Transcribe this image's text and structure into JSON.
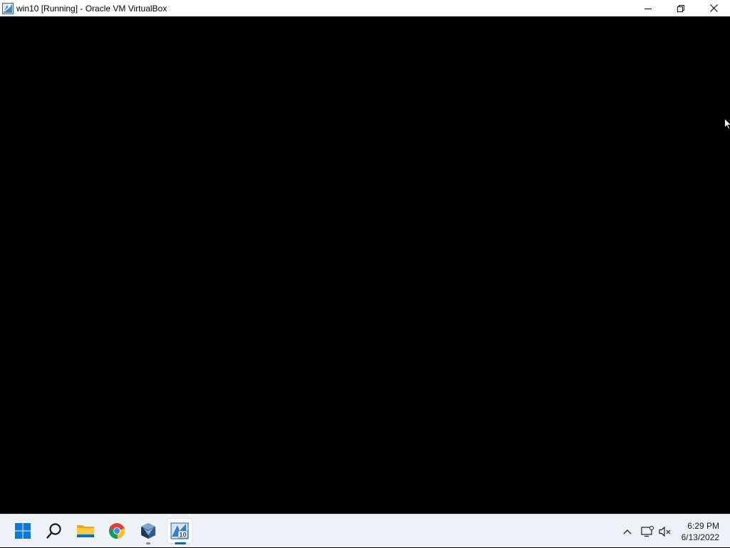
{
  "window": {
    "title": "win10 [Running] - Oracle VM VirtualBox",
    "icon": "virtualbox-vm-icon",
    "controls": [
      "minimize-icon",
      "restore-icon",
      "close-icon"
    ]
  },
  "taskbar": {
    "apps": [
      {
        "name": "start",
        "icon": "windows-logo-icon"
      },
      {
        "name": "search",
        "icon": "search-icon"
      },
      {
        "name": "file-explorer",
        "icon": "folder-icon"
      },
      {
        "name": "chrome",
        "icon": "chrome-icon"
      },
      {
        "name": "virtualbox-manager",
        "icon": "virtualbox-icon",
        "running": true
      },
      {
        "name": "vm-win10",
        "icon": "vm-window-icon",
        "active": true,
        "badge": "10"
      }
    ],
    "tray": {
      "icons": [
        "chevron-up-icon",
        "network-icon",
        "speaker-muted-icon"
      ],
      "time": "6:29 PM",
      "date": "6/13/2022"
    }
  },
  "colors": {
    "taskbar_bg": "#eef2f6",
    "accent": "#0067c0",
    "vm_screen": "#000000"
  }
}
